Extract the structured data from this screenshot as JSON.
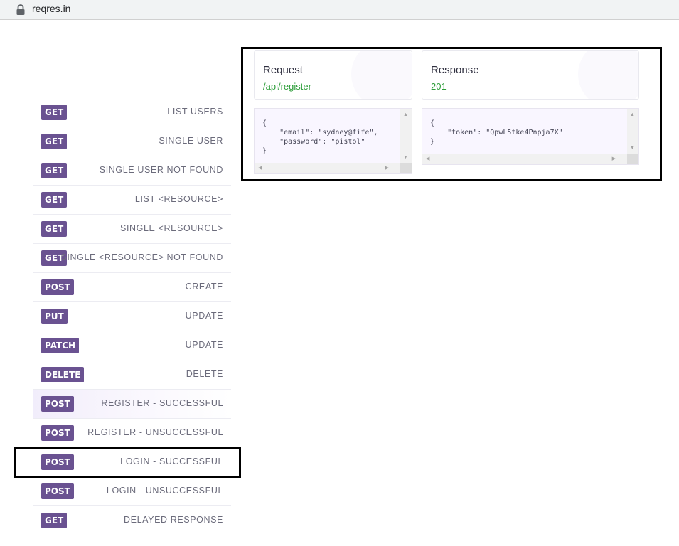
{
  "browser": {
    "url": "reqres.in"
  },
  "endpoints": [
    {
      "method": "GET",
      "label": "LIST USERS"
    },
    {
      "method": "GET",
      "label": "SINGLE USER"
    },
    {
      "method": "GET",
      "label": "SINGLE USER NOT FOUND"
    },
    {
      "method": "GET",
      "label": "LIST <RESOURCE>"
    },
    {
      "method": "GET",
      "label": "SINGLE <RESOURCE>"
    },
    {
      "method": "GET",
      "label": "SINGLE <RESOURCE> NOT FOUND"
    },
    {
      "method": "POST",
      "label": "CREATE"
    },
    {
      "method": "PUT",
      "label": "UPDATE"
    },
    {
      "method": "PATCH",
      "label": "UPDATE"
    },
    {
      "method": "DELETE",
      "label": "DELETE"
    },
    {
      "method": "POST",
      "label": "REGISTER - SUCCESSFUL"
    },
    {
      "method": "POST",
      "label": "REGISTER - UNSUCCESSFUL"
    },
    {
      "method": "POST",
      "label": "LOGIN - SUCCESSFUL"
    },
    {
      "method": "POST",
      "label": "LOGIN - UNSUCCESSFUL"
    },
    {
      "method": "GET",
      "label": "DELAYED RESPONSE"
    }
  ],
  "request": {
    "title": "Request",
    "path": "/api/register",
    "body": "{\n    \"email\": \"sydney@fife\",\n    \"password\": \"pistol\"\n}"
  },
  "response": {
    "title": "Response",
    "status": "201",
    "body": "{\n    \"token\": \"QpwL5tke4Pnpja7X\"\n}"
  },
  "colors": {
    "badge": "#6a5291",
    "status_green": "#2e9e3a",
    "active_row": "#f1edfb",
    "code_bg": "#f9f6ff",
    "highlight": "#000000"
  }
}
